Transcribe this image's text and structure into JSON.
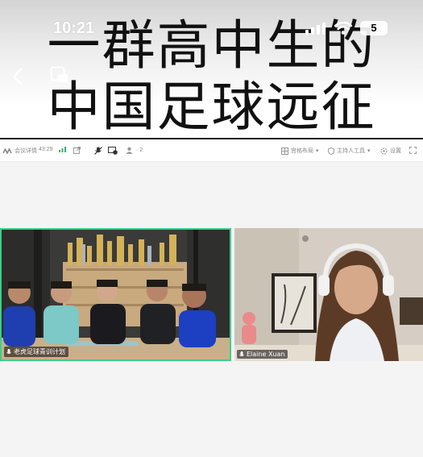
{
  "status_bar": {
    "time": "10:21",
    "battery": "5"
  },
  "banner": {
    "line1": "一群高中生的",
    "line2": "中国足球远征"
  },
  "toolbar": {
    "meeting_info": "会议详情",
    "duration": "43:29",
    "participants_count": "2",
    "layout": "宫格布局",
    "host_tools": "主持人工具",
    "settings": "设置"
  },
  "tiles": [
    {
      "name": "老虎足球青训计划",
      "mic": "on",
      "active_speaker": true
    },
    {
      "name": "Elaine Xuan",
      "mic": "on",
      "active_speaker": false
    }
  ],
  "colors": {
    "active_border": "#39d08a",
    "signal": "#31b36b"
  }
}
